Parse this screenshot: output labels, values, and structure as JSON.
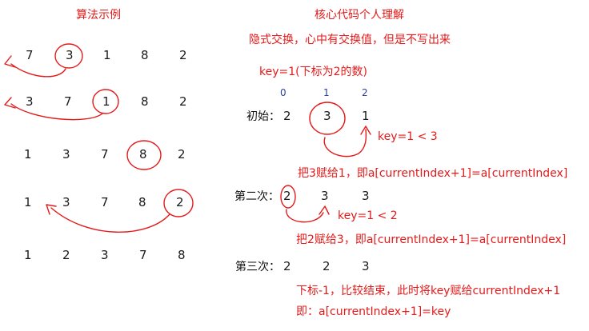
{
  "left": {
    "title": "算法示例",
    "rows": [
      [
        "7",
        "3",
        "1",
        "8",
        "2"
      ],
      [
        "3",
        "7",
        "1",
        "8",
        "2"
      ],
      [
        "1",
        "3",
        "7",
        "8",
        "2"
      ],
      [
        "1",
        "3",
        "7",
        "8",
        "2"
      ],
      [
        "1",
        "2",
        "3",
        "7",
        "8"
      ]
    ]
  },
  "right": {
    "title": "核心代码个人理解",
    "note": "隐式交换，心中有交换值，但是不写出来",
    "key_line": "key=1(下标为2的数)",
    "index_marks": [
      "0",
      "1",
      "2"
    ],
    "states": [
      {
        "label": "初始：",
        "values": [
          "2",
          "3",
          "1"
        ]
      },
      {
        "label": "第二次：",
        "values": [
          "2",
          "3",
          "3"
        ]
      },
      {
        "label": "第三次：",
        "values": [
          "2",
          "2",
          "3"
        ]
      }
    ],
    "annotations": [
      "key=1 < 3",
      "把3赋给1，即a[currentIndex+1]=a[currentIndex]",
      "key=1 < 2",
      "把2赋给3，即a[currentIndex+1]=a[currentIndex]",
      "下标-1，比较结束，此时将key赋给currentIndex+1",
      "即：a[currentIndex+1]=key"
    ]
  }
}
